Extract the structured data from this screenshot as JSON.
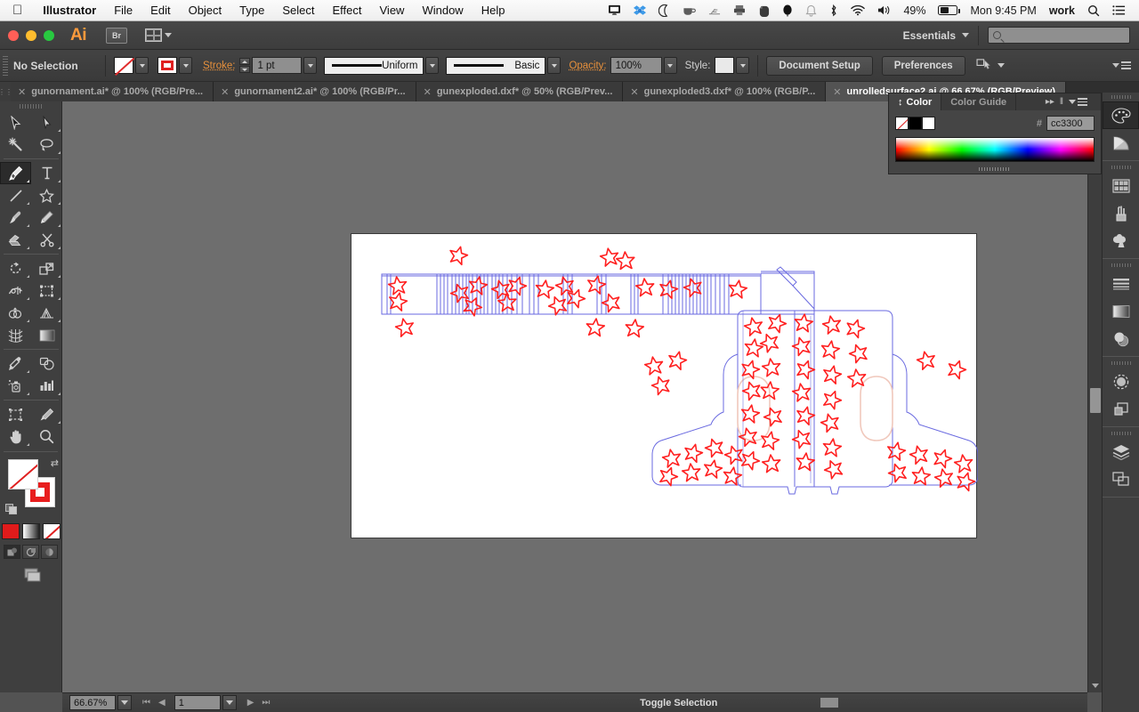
{
  "menubar": {
    "apple": "apple-logo",
    "items": [
      "Illustrator",
      "File",
      "Edit",
      "Object",
      "Type",
      "Select",
      "Effect",
      "View",
      "Window",
      "Help"
    ],
    "status_icons": [
      "display-icon",
      "dropbox-icon",
      "moon-icon",
      "coffee-icon",
      "antenna-icon",
      "printer-icon",
      "evernote-icon",
      "balloon-icon",
      "bell-icon",
      "bluetooth-icon",
      "wifi-icon",
      "volume-icon"
    ],
    "battery_percent": "49%",
    "clock": "Mon 9:45 PM",
    "user": "work",
    "search_icon": "search-icon",
    "notification_icon": "notification-center-icon"
  },
  "titlebar": {
    "app_logo": "Ai",
    "bridge_label": "Br",
    "arrange_icon": "arrange-documents-icon",
    "workspace": "Essentials",
    "search_placeholder": ""
  },
  "control_bar": {
    "selection_status": "No Selection",
    "fill_label": "fill-swatch-none",
    "stroke_swatch_label": "stroke-swatch-red",
    "stroke_label": "Stroke:",
    "stroke_weight": "1 pt",
    "stroke_profile": "Uniform",
    "brush_definition": "Basic",
    "opacity_label": "Opacity:",
    "opacity_value": "100%",
    "style_label": "Style:",
    "document_setup": "Document Setup",
    "preferences": "Preferences",
    "select_similar_icon": "select-similar-icon",
    "panel_menu_icon": "panel-menu-icon"
  },
  "tabs": [
    {
      "title": "gunornament.ai* @ 100% (RGB/Pre...",
      "active": false
    },
    {
      "title": "gunornament2.ai* @ 100% (RGB/Pr...",
      "active": false
    },
    {
      "title": "gunexploded.dxf* @ 50% (RGB/Prev...",
      "active": false
    },
    {
      "title": "gunexploded3.dxf* @ 100% (RGB/P...",
      "active": false
    },
    {
      "title": "unrolledsurface2.ai @ 66.67% (RGB/Preview)",
      "active": true
    }
  ],
  "toolbar": {
    "tools": [
      {
        "name": "selection-tool",
        "glyph": "arrow"
      },
      {
        "name": "direct-selection-tool",
        "glyph": "arrow-white"
      },
      {
        "name": "magic-wand-tool",
        "glyph": "wand"
      },
      {
        "name": "lasso-tool",
        "glyph": "lasso"
      },
      {
        "name": "pen-tool",
        "glyph": "pen",
        "selected": true
      },
      {
        "name": "type-tool",
        "glyph": "T"
      },
      {
        "name": "line-segment-tool",
        "glyph": "line"
      },
      {
        "name": "star-tool",
        "glyph": "star"
      },
      {
        "name": "paintbrush-tool",
        "glyph": "brush"
      },
      {
        "name": "pencil-tool",
        "glyph": "pencil"
      },
      {
        "name": "blob-brush-tool",
        "glyph": "blob"
      },
      {
        "name": "scissors-tool",
        "glyph": "scissors"
      },
      {
        "name": "rotate-tool",
        "glyph": "rotate"
      },
      {
        "name": "scale-tool",
        "glyph": "scale"
      },
      {
        "name": "width-tool",
        "glyph": "width"
      },
      {
        "name": "free-transform-tool",
        "glyph": "transform"
      },
      {
        "name": "shape-builder-tool",
        "glyph": "shapebuilder"
      },
      {
        "name": "perspective-grid-tool",
        "glyph": "perspective"
      },
      {
        "name": "mesh-tool",
        "glyph": "mesh"
      },
      {
        "name": "gradient-tool",
        "glyph": "gradient"
      },
      {
        "name": "eyedropper-tool",
        "glyph": "eyedropper"
      },
      {
        "name": "blend-tool",
        "glyph": "blend"
      },
      {
        "name": "symbol-sprayer-tool",
        "glyph": "sprayer"
      },
      {
        "name": "column-graph-tool",
        "glyph": "graph"
      },
      {
        "name": "artboard-tool",
        "glyph": "artboard"
      },
      {
        "name": "slice-tool",
        "glyph": "slice"
      },
      {
        "name": "hand-tool",
        "glyph": "hand"
      },
      {
        "name": "zoom-tool",
        "glyph": "zoom"
      }
    ],
    "fill_stroke": {
      "fill": "none",
      "stroke": "#e81e1e",
      "swap_icon": "swap-fill-stroke-icon",
      "default_icon": "default-fill-stroke-icon"
    },
    "modes": [
      "color-mode",
      "gradient-mode",
      "none-mode"
    ],
    "draw_modes": [
      "draw-normal",
      "draw-behind",
      "draw-inside"
    ],
    "screen_mode": "screen-mode-icon"
  },
  "color_panel": {
    "tabs": [
      "Color",
      "Color Guide"
    ],
    "active_tab": "Color",
    "swatches": [
      "none",
      "#000000",
      "#ffffff"
    ],
    "hash": "#",
    "hex_value": "cc3300",
    "collapse_icon": "collapse-panel-icon",
    "menu_icon": "panel-menu-icon"
  },
  "dock": {
    "groups": [
      [
        {
          "name": "color-panel-icon",
          "active": true
        },
        {
          "name": "color-guide-icon",
          "active": false
        }
      ],
      [
        {
          "name": "swatches-panel-icon",
          "active": false
        },
        {
          "name": "brushes-panel-icon",
          "active": false
        },
        {
          "name": "symbols-panel-icon",
          "active": false
        }
      ],
      [
        {
          "name": "stroke-panel-icon",
          "active": false
        },
        {
          "name": "gradient-panel-icon",
          "active": false
        },
        {
          "name": "transparency-panel-icon",
          "active": false
        }
      ],
      [
        {
          "name": "appearance-panel-icon",
          "active": false
        },
        {
          "name": "graphic-styles-panel-icon",
          "active": false
        }
      ],
      [
        {
          "name": "layers-panel-icon",
          "active": false
        },
        {
          "name": "artboards-panel-icon",
          "active": false
        }
      ]
    ]
  },
  "status_bar": {
    "zoom_level": "66.67%",
    "artboard_number": "1",
    "status_text": "Toggle Selection",
    "first_icon": "first-artboard-icon",
    "prev_icon": "previous-artboard-icon",
    "next_icon": "next-artboard-icon",
    "last_icon": "last-artboard-icon"
  },
  "artwork": {
    "description": "unrolled-gun-papercraft-template",
    "cut_line_color": "#6a6ae0",
    "star_color": "#ff2020",
    "opening_color": "#f6cfc4",
    "band_segments": 7,
    "canvas_background": "#6e6e6e",
    "artboard_background": "#ffffff"
  }
}
